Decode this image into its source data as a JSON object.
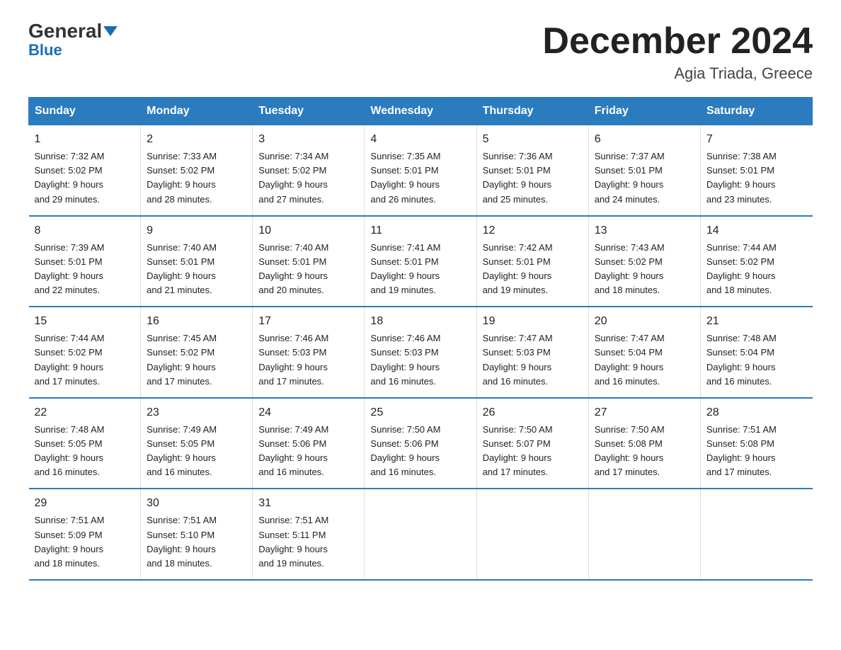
{
  "logo": {
    "general": "General",
    "blue": "Blue",
    "tagline": ""
  },
  "title": "December 2024",
  "subtitle": "Agia Triada, Greece",
  "days_of_week": [
    "Sunday",
    "Monday",
    "Tuesday",
    "Wednesday",
    "Thursday",
    "Friday",
    "Saturday"
  ],
  "weeks": [
    [
      {
        "day": "1",
        "sunrise": "7:32 AM",
        "sunset": "5:02 PM",
        "daylight": "9 hours and 29 minutes."
      },
      {
        "day": "2",
        "sunrise": "7:33 AM",
        "sunset": "5:02 PM",
        "daylight": "9 hours and 28 minutes."
      },
      {
        "day": "3",
        "sunrise": "7:34 AM",
        "sunset": "5:02 PM",
        "daylight": "9 hours and 27 minutes."
      },
      {
        "day": "4",
        "sunrise": "7:35 AM",
        "sunset": "5:01 PM",
        "daylight": "9 hours and 26 minutes."
      },
      {
        "day": "5",
        "sunrise": "7:36 AM",
        "sunset": "5:01 PM",
        "daylight": "9 hours and 25 minutes."
      },
      {
        "day": "6",
        "sunrise": "7:37 AM",
        "sunset": "5:01 PM",
        "daylight": "9 hours and 24 minutes."
      },
      {
        "day": "7",
        "sunrise": "7:38 AM",
        "sunset": "5:01 PM",
        "daylight": "9 hours and 23 minutes."
      }
    ],
    [
      {
        "day": "8",
        "sunrise": "7:39 AM",
        "sunset": "5:01 PM",
        "daylight": "9 hours and 22 minutes."
      },
      {
        "day": "9",
        "sunrise": "7:40 AM",
        "sunset": "5:01 PM",
        "daylight": "9 hours and 21 minutes."
      },
      {
        "day": "10",
        "sunrise": "7:40 AM",
        "sunset": "5:01 PM",
        "daylight": "9 hours and 20 minutes."
      },
      {
        "day": "11",
        "sunrise": "7:41 AM",
        "sunset": "5:01 PM",
        "daylight": "9 hours and 19 minutes."
      },
      {
        "day": "12",
        "sunrise": "7:42 AM",
        "sunset": "5:01 PM",
        "daylight": "9 hours and 19 minutes."
      },
      {
        "day": "13",
        "sunrise": "7:43 AM",
        "sunset": "5:02 PM",
        "daylight": "9 hours and 18 minutes."
      },
      {
        "day": "14",
        "sunrise": "7:44 AM",
        "sunset": "5:02 PM",
        "daylight": "9 hours and 18 minutes."
      }
    ],
    [
      {
        "day": "15",
        "sunrise": "7:44 AM",
        "sunset": "5:02 PM",
        "daylight": "9 hours and 17 minutes."
      },
      {
        "day": "16",
        "sunrise": "7:45 AM",
        "sunset": "5:02 PM",
        "daylight": "9 hours and 17 minutes."
      },
      {
        "day": "17",
        "sunrise": "7:46 AM",
        "sunset": "5:03 PM",
        "daylight": "9 hours and 17 minutes."
      },
      {
        "day": "18",
        "sunrise": "7:46 AM",
        "sunset": "5:03 PM",
        "daylight": "9 hours and 16 minutes."
      },
      {
        "day": "19",
        "sunrise": "7:47 AM",
        "sunset": "5:03 PM",
        "daylight": "9 hours and 16 minutes."
      },
      {
        "day": "20",
        "sunrise": "7:47 AM",
        "sunset": "5:04 PM",
        "daylight": "9 hours and 16 minutes."
      },
      {
        "day": "21",
        "sunrise": "7:48 AM",
        "sunset": "5:04 PM",
        "daylight": "9 hours and 16 minutes."
      }
    ],
    [
      {
        "day": "22",
        "sunrise": "7:48 AM",
        "sunset": "5:05 PM",
        "daylight": "9 hours and 16 minutes."
      },
      {
        "day": "23",
        "sunrise": "7:49 AM",
        "sunset": "5:05 PM",
        "daylight": "9 hours and 16 minutes."
      },
      {
        "day": "24",
        "sunrise": "7:49 AM",
        "sunset": "5:06 PM",
        "daylight": "9 hours and 16 minutes."
      },
      {
        "day": "25",
        "sunrise": "7:50 AM",
        "sunset": "5:06 PM",
        "daylight": "9 hours and 16 minutes."
      },
      {
        "day": "26",
        "sunrise": "7:50 AM",
        "sunset": "5:07 PM",
        "daylight": "9 hours and 17 minutes."
      },
      {
        "day": "27",
        "sunrise": "7:50 AM",
        "sunset": "5:08 PM",
        "daylight": "9 hours and 17 minutes."
      },
      {
        "day": "28",
        "sunrise": "7:51 AM",
        "sunset": "5:08 PM",
        "daylight": "9 hours and 17 minutes."
      }
    ],
    [
      {
        "day": "29",
        "sunrise": "7:51 AM",
        "sunset": "5:09 PM",
        "daylight": "9 hours and 18 minutes."
      },
      {
        "day": "30",
        "sunrise": "7:51 AM",
        "sunset": "5:10 PM",
        "daylight": "9 hours and 18 minutes."
      },
      {
        "day": "31",
        "sunrise": "7:51 AM",
        "sunset": "5:11 PM",
        "daylight": "9 hours and 19 minutes."
      },
      null,
      null,
      null,
      null
    ]
  ],
  "colors": {
    "header_bg": "#2b7bbf",
    "header_text": "#ffffff",
    "border": "#2b7bbf",
    "body_text": "#222222"
  },
  "labels": {
    "sunrise_prefix": "Sunrise: ",
    "sunset_prefix": "Sunset: ",
    "daylight_prefix": "Daylight: "
  }
}
